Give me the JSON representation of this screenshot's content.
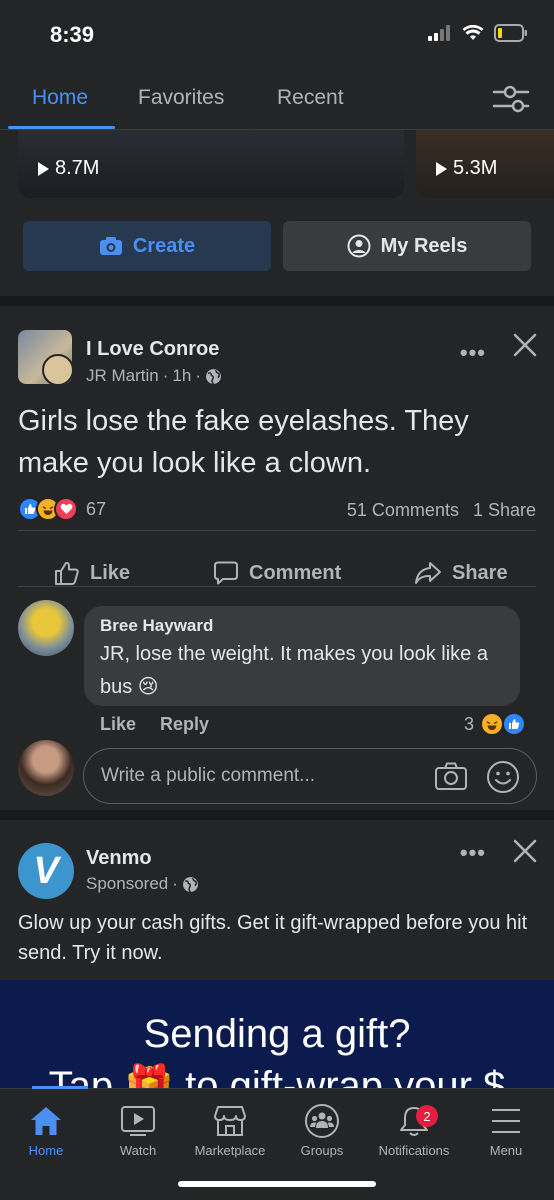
{
  "status": {
    "time": "8:39"
  },
  "tabs": [
    {
      "label": "Home"
    },
    {
      "label": "Favorites"
    },
    {
      "label": "Recent"
    }
  ],
  "reels": {
    "views": [
      "8.7M",
      "5.3M"
    ],
    "create_label": "Create",
    "my_reels_label": "My Reels"
  },
  "post1": {
    "page_name": "I Love Conroe",
    "author": "JR Martin",
    "time": "1h",
    "text": "Girls lose the fake eyelashes. They make you look like a clown.",
    "reaction_count": "67",
    "comments": "51 Comments",
    "shares": "1 Share",
    "actions": {
      "like": "Like",
      "comment": "Comment",
      "share": "Share"
    },
    "top_comment": {
      "author": "Bree Hayward",
      "text": "JR, lose the weight. It makes you look like a bus 😢",
      "like": "Like",
      "reply": "Reply",
      "reaction_count": "3"
    },
    "write_placeholder": "Write a public comment..."
  },
  "post2": {
    "advertiser": "Venmo",
    "sponsored": "Sponsored",
    "text": "Glow up your cash gifts. Get it gift-wrapped before you hit send. Try it now.",
    "banner_line1": "Sending a gift?",
    "banner_line2": "Tap 🎁 to gift-wrap your $"
  },
  "bottom_nav": [
    {
      "label": "Home",
      "icon": "home-icon"
    },
    {
      "label": "Watch",
      "icon": "watch-icon"
    },
    {
      "label": "Marketplace",
      "icon": "marketplace-icon"
    },
    {
      "label": "Groups",
      "icon": "groups-icon"
    },
    {
      "label": "Notifications",
      "icon": "bell-icon",
      "badge": "2"
    },
    {
      "label": "Menu",
      "icon": "menu-icon"
    }
  ],
  "colors": {
    "accent": "#4b8ff5",
    "background": "#242526",
    "badge": "#e41e3f",
    "venmo": "#3d95ce"
  }
}
